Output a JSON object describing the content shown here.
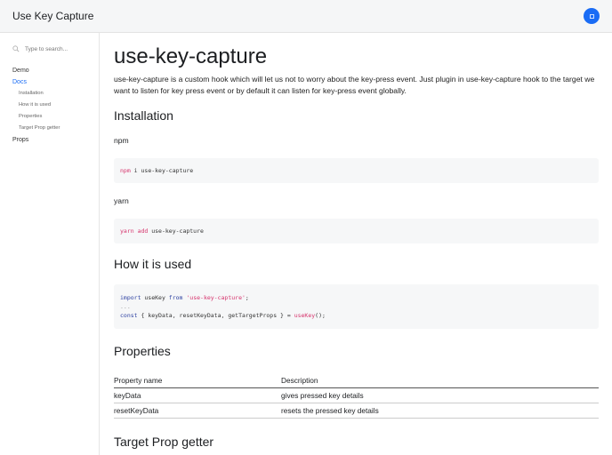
{
  "header": {
    "title": "Use Key Capture"
  },
  "sidebar": {
    "search_placeholder": "Type to search...",
    "items": [
      {
        "label": "Demo"
      },
      {
        "label": "Docs"
      },
      {
        "label": "Installation"
      },
      {
        "label": "How it is used"
      },
      {
        "label": "Properties"
      },
      {
        "label": "Target Prop getter"
      },
      {
        "label": "Props"
      }
    ]
  },
  "main": {
    "title": "use-key-capture",
    "intro": "use-key-capture is a custom hook which will let us not to worry about the key-press event. Just plugin in use-key-capture hook to the target we want to listen for key press event or by default it can listen for key-press event globally.",
    "installation": {
      "heading": "Installation",
      "npm_label": "npm",
      "npm_cmd": "npm",
      "npm_rest": " i use-key-capture",
      "yarn_label": "yarn",
      "yarn_cmd": "yarn add",
      "yarn_rest": " use-key-capture"
    },
    "usage": {
      "heading": "How it is used",
      "import": "import",
      "usekey": " useKey ",
      "from": "from",
      "module": "'use-key-capture'",
      "semi": ";",
      "dots": "...",
      "const": "const",
      "destructure": " { keyData, resetKeyData, getTargetProps } = ",
      "call": "useKey",
      "end": "();"
    },
    "properties": {
      "heading": "Properties",
      "columns": [
        "Property name",
        "Description"
      ],
      "rows": [
        [
          "keyData",
          "gives pressed key details"
        ],
        [
          "resetKeyData",
          "resets the pressed key details"
        ]
      ]
    },
    "target_heading": "Target Prop getter"
  }
}
